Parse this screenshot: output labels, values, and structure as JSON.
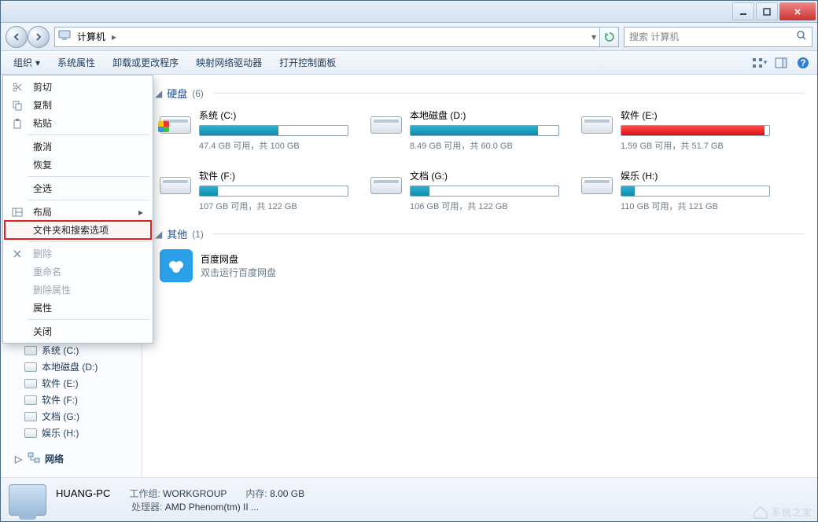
{
  "titlebar": {
    "minimize": "minimize",
    "maximize": "maximize",
    "close": "close"
  },
  "address": {
    "icon_hint": "computer",
    "segments": [
      "计算机"
    ],
    "dropdown_hint": "▾",
    "refresh_hint": "refresh"
  },
  "search": {
    "placeholder": "搜索 计算机"
  },
  "toolbar": {
    "organize": "组织",
    "items": [
      "系统属性",
      "卸载或更改程序",
      "映射网络驱动器",
      "打开控制面板"
    ]
  },
  "organize_menu": {
    "items": [
      {
        "key": "cut",
        "label": "剪切",
        "icon": "scissors",
        "enabled": true
      },
      {
        "key": "copy",
        "label": "复制",
        "icon": "copy",
        "enabled": true
      },
      {
        "key": "paste",
        "label": "粘贴",
        "icon": "paste",
        "enabled": true
      },
      {
        "sep": true
      },
      {
        "key": "undo",
        "label": "撤消",
        "enabled": true
      },
      {
        "key": "redo",
        "label": "恢复",
        "enabled": true
      },
      {
        "sep": true
      },
      {
        "key": "selectall",
        "label": "全选",
        "enabled": true
      },
      {
        "sep": true
      },
      {
        "key": "layout",
        "label": "布局",
        "icon": "layout",
        "enabled": true,
        "submenu": true
      },
      {
        "key": "folderopts",
        "label": "文件夹和搜索选项",
        "enabled": true,
        "highlight": true
      },
      {
        "sep": true
      },
      {
        "key": "delete",
        "label": "删除",
        "icon": "delete",
        "enabled": false
      },
      {
        "key": "rename",
        "label": "重命名",
        "enabled": false
      },
      {
        "key": "removeprops",
        "label": "删除属性",
        "enabled": false
      },
      {
        "key": "props",
        "label": "属性",
        "enabled": true
      },
      {
        "sep": true
      },
      {
        "key": "close",
        "label": "关闭",
        "enabled": true
      }
    ]
  },
  "sidebar": {
    "items": [
      {
        "label": "系统 (C:)",
        "indent": 1,
        "icon": "drive"
      },
      {
        "label": "本地磁盘 (D:)",
        "indent": 1,
        "icon": "drive"
      },
      {
        "label": "软件 (E:)",
        "indent": 1,
        "icon": "drive"
      },
      {
        "label": "软件 (F:)",
        "indent": 1,
        "icon": "drive"
      },
      {
        "label": "文档 (G:)",
        "indent": 1,
        "icon": "drive"
      },
      {
        "label": "娱乐 (H:)",
        "indent": 1,
        "icon": "drive"
      },
      {
        "label": "网络",
        "indent": 0,
        "icon": "network",
        "expander": "▷"
      }
    ]
  },
  "groups": [
    {
      "title": "硬盘",
      "count": "(6)",
      "drives": [
        {
          "name": "系统 (C:)",
          "free": "47.4 GB 可用，共 100 GB",
          "fill": 53,
          "color": "teal",
          "os": true
        },
        {
          "name": "本地磁盘 (D:)",
          "free": "8.49 GB 可用，共 60.0 GB",
          "fill": 86,
          "color": "teal"
        },
        {
          "name": "软件 (E:)",
          "free": "1.59 GB 可用，共 51.7 GB",
          "fill": 97,
          "color": "red"
        },
        {
          "name": "软件 (F:)",
          "free": "107 GB 可用，共 122 GB",
          "fill": 12,
          "color": "teal"
        },
        {
          "name": "文档 (G:)",
          "free": "106 GB 可用，共 122 GB",
          "fill": 13,
          "color": "teal"
        },
        {
          "name": "娱乐 (H:)",
          "free": "110 GB 可用，共 121 GB",
          "fill": 9,
          "color": "teal"
        }
      ]
    }
  ],
  "other_group": {
    "title": "其他",
    "count": "(1)",
    "items": [
      {
        "name": "百度网盘",
        "sub": "双击运行百度网盘"
      }
    ]
  },
  "status": {
    "pcname": "HUANG-PC",
    "workgroup_label": "工作组:",
    "workgroup": "WORKGROUP",
    "memory_label": "内存:",
    "memory": "8.00 GB",
    "cpu_label": "处理器:",
    "cpu": "AMD Phenom(tm) II ..."
  },
  "watermark": "系统之家"
}
